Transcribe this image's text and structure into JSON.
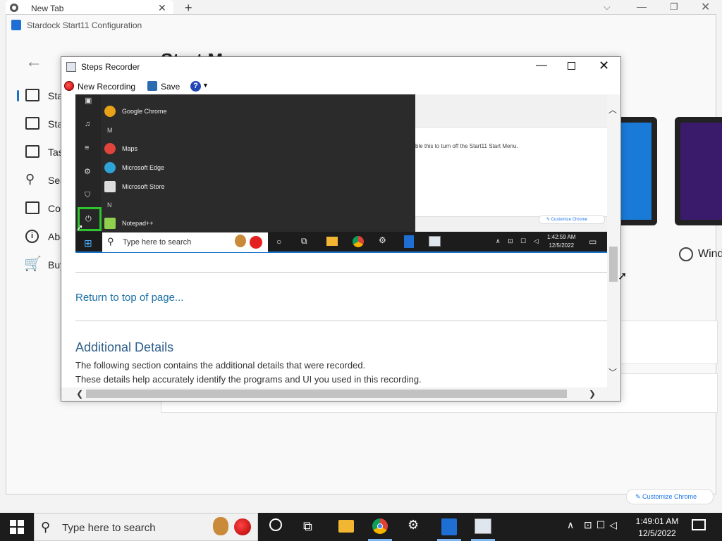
{
  "browser": {
    "tab_title": "New Tab",
    "tab_close": "✕",
    "new_tab": "+",
    "tab_search": "⌵",
    "minimize": "—",
    "maximize": "❐",
    "close": "✕"
  },
  "start11": {
    "window_title": "Stardock Start11 Configuration",
    "heading": "Start M",
    "back": "←",
    "nav": [
      {
        "label": "Sta"
      },
      {
        "label": "Sta"
      },
      {
        "label": "Tas"
      },
      {
        "label": "Sea"
      },
      {
        "label": "Co"
      },
      {
        "label": "Abo"
      },
      {
        "label": "Buy"
      }
    ],
    "radio_label": "Wind",
    "customize_chrome": "Customize Chrome"
  },
  "steps_recorder": {
    "title": "Steps Recorder",
    "minimize": "—",
    "close": "✕",
    "toolbar": {
      "new_recording": "New Recording",
      "save": "Save",
      "help": "?",
      "help_arrow": "▼"
    },
    "embedded": {
      "apps": [
        {
          "label": "Google Chrome",
          "color": "#e8a317"
        },
        {
          "label": "Maps",
          "color": "#e0443a"
        },
        {
          "label": "Microsoft Edge",
          "color": "#2ea3d8"
        },
        {
          "label": "Microsoft Store",
          "color": "#dddddd"
        },
        {
          "label": "Notepad++",
          "color": "#8fd14f"
        }
      ],
      "letters": [
        "M",
        "N"
      ],
      "hint": "ble this to turn off the Start11 Start Menu.",
      "customize": "Customize Chrome",
      "search_placeholder": "Type here to search",
      "clock_time": "1:42:59 AM",
      "clock_date": "12/5/2022"
    },
    "return_link": "Return to top of page...",
    "details_heading": "Additional Details",
    "details_line1": "The following section contains the additional details that were recorded.",
    "details_line2": "These details help accurately identify the programs and UI you used in this recording."
  },
  "taskbar": {
    "search_placeholder": "Type here to search",
    "clock_time": "1:49:01 AM",
    "clock_date": "12/5/2022",
    "tray_chevron": "∧"
  },
  "colors": {
    "accent": "#1a73c8",
    "link": "#1a6fa5",
    "heading": "#2f5f8a",
    "taskbar": "#1c1c1c",
    "highlight": "#2ec52e"
  }
}
